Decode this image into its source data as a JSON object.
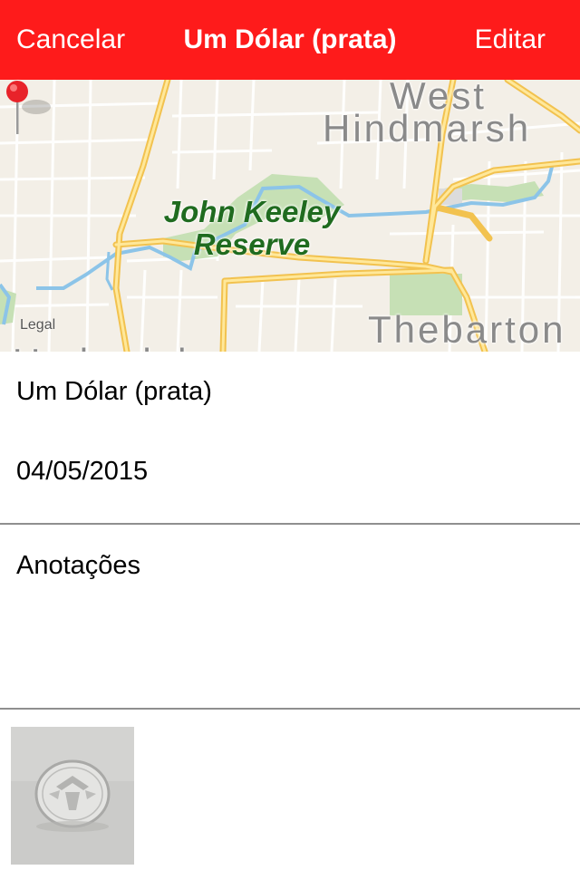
{
  "navbar": {
    "cancel_label": "Cancelar",
    "title": "Um Dólar (prata)",
    "edit_label": "Editar",
    "bg_color": "#fe1b1b"
  },
  "map": {
    "labels": {
      "west": "West",
      "hindmarsh": "Hindmarsh",
      "thebarton": "Thebarton",
      "underdale": "Underdale"
    },
    "park_name_line1": "John Keeley",
    "park_name_line2": "Reserve",
    "legal": "Legal",
    "pin_icon": "map-pin-icon"
  },
  "item": {
    "name": "Um Dólar (prata)",
    "date": "04/05/2015"
  },
  "notes": {
    "label": "Anotações"
  },
  "photo": {
    "subject": "silver-dollar-coin-photo"
  }
}
